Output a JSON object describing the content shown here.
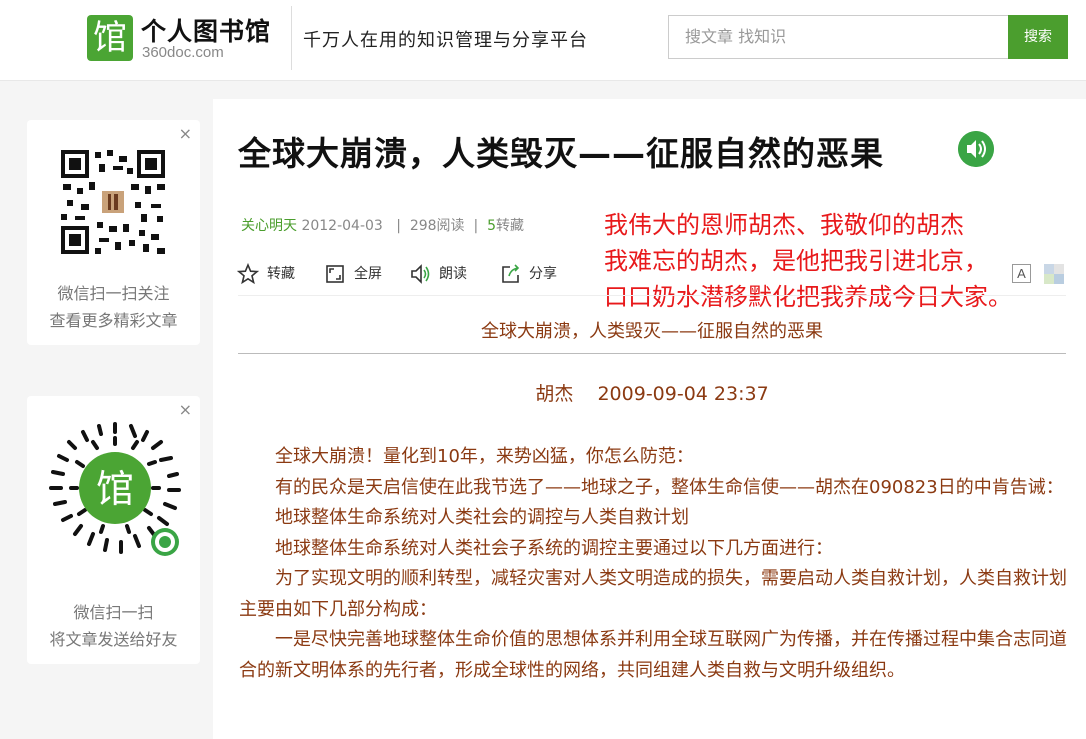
{
  "header": {
    "logo_glyph": "馆",
    "logo_title": "个人图书馆",
    "logo_domain": "360doc.com",
    "slogan": "千万人在用的知识管理与分享平台",
    "search_placeholder": "搜文章  找知识",
    "search_button": "搜索"
  },
  "sidebar": {
    "card1": {
      "close": "×",
      "line1": "微信扫一扫关注",
      "line2": "查看更多精彩文章"
    },
    "card2": {
      "close": "×",
      "logo_glyph": "馆",
      "line1": "微信扫一扫",
      "line2": "将文章发送给好友"
    }
  },
  "article": {
    "title": "全球大崩溃，人类毁灭——征服自然的恶果",
    "meta": {
      "author": "关心明天",
      "date": "2012-04-03",
      "separator": "|",
      "reads": "298阅读",
      "favorites_count": "5",
      "favorites_label": "转藏"
    },
    "toolbar": {
      "favorite": "转藏",
      "fullscreen": "全屏",
      "read_aloud": "朗读",
      "share": "分享"
    },
    "font_button": "A",
    "overlay_lines": [
      "我伟大的恩师胡杰、我敬仰的胡杰",
      "我难忘的胡杰，是他把我引进北京，",
      "口口奶水潜移默化把我养成今日大家。"
    ],
    "subtitle": "全球大崩溃，人类毁灭——征服自然的恶果",
    "byline": "胡杰    2009-09-04 23:37",
    "paragraphs": [
      "全球大崩溃！量化到10年，来势凶猛，你怎么防范：",
      "有的民众是天启信使在此我节选了——地球之子，整体生命信使——胡杰在090823日的中肯告诫：",
      "地球整体生命系统对人类社会的调控与人类自救计划",
      "地球整体生命系统对人类社会子系统的调控主要通过以下几方面进行：",
      "为了实现文明的顺利转型，减轻灾害对人类文明造成的损失，需要启动人类自救计划，人类自救计划主要由如下几部分构成：",
      "一是尽快完善地球整体生命价值的思想体系并利用全球互联网广为传播，并在传播过程中集合志同道合的新文明体系的先行者，形成全球性的网络，共同组建人类自救与文明升级组织。"
    ]
  },
  "colors": {
    "brand_green": "#4b9e2e",
    "article_text": "#8b3a12",
    "overlay_red": "#e8191b"
  }
}
